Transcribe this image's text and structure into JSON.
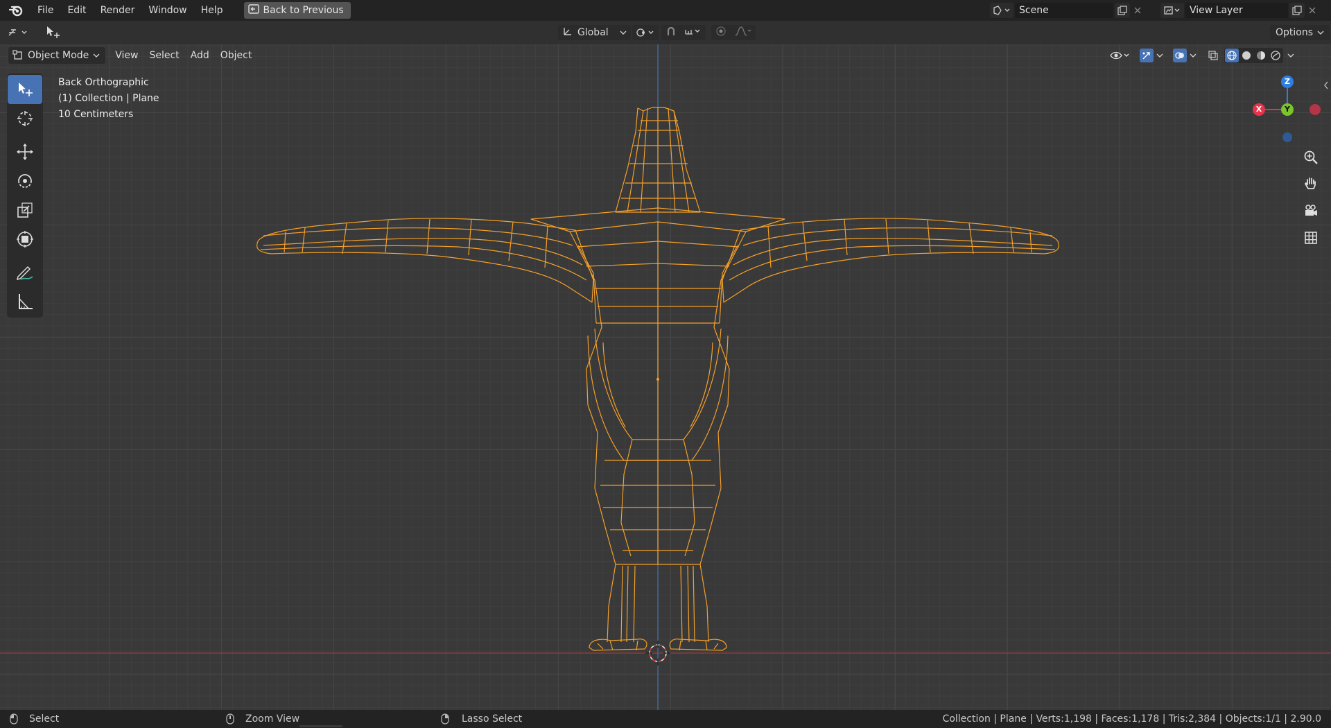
{
  "app": {
    "menu": [
      "File",
      "Edit",
      "Render",
      "Window",
      "Help"
    ],
    "back_button": "Back to Previous",
    "scene": "Scene",
    "view_layer": "View Layer"
  },
  "tool_header": {
    "transform_orientation": "Global",
    "options_label": "Options"
  },
  "viewport_header": {
    "mode": "Object Mode",
    "menus": [
      "View",
      "Select",
      "Add",
      "Object"
    ]
  },
  "viewport": {
    "view_name": "Back Orthographic",
    "collection_info": "(1) Collection | Plane",
    "grid_scale": "10 Centimeters",
    "axes": {
      "x": "X",
      "y": "Y",
      "z": "Z"
    }
  },
  "toolbar": {
    "tools": [
      "select-box",
      "cursor",
      "move",
      "rotate",
      "scale",
      "transform",
      "annotate",
      "measure"
    ]
  },
  "statusbar": {
    "left_action": "Select",
    "middle_action": "Zoom View",
    "right_action": "Lasso Select",
    "stats": "Collection | Plane | Verts:1,198 | Faces:1,178 | Tris:2,384 | Objects:1/1 | 2.90.0"
  },
  "colors": {
    "accent": "#4772b3",
    "wire_selected": "#f5a02a",
    "x_axis": "#e8334a",
    "y_axis": "#7ac42e",
    "z_axis": "#2e7fe0"
  }
}
